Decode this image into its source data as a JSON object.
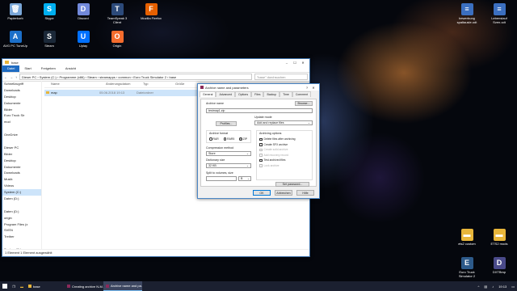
{
  "desktop": {
    "icons_top": [
      {
        "label": "Papierkorb",
        "icon": "recycle-bin-icon",
        "color": "#7aa7d8",
        "glyph": "🗑"
      },
      {
        "label": "Skype",
        "icon": "skype-icon",
        "color": "#00aff0",
        "glyph": "S"
      },
      {
        "label": "Discord",
        "icon": "discord-icon",
        "color": "#7289da",
        "glyph": "D"
      },
      {
        "label": "TeamSpeak 3 Client",
        "icon": "teamspeak-icon",
        "color": "#2c4a7a",
        "glyph": "T"
      },
      {
        "label": "Mozilla Firefox",
        "icon": "firefox-icon",
        "color": "#e66000",
        "glyph": "F"
      }
    ],
    "icons_second": [
      {
        "label": "AVG PC TuneUp",
        "icon": "avg-tuneup-icon",
        "color": "#1b6fc9",
        "glyph": "A"
      },
      {
        "label": "Steam",
        "icon": "steam-icon",
        "color": "#1b2838",
        "glyph": "S"
      },
      {
        "label": "Uplay",
        "icon": "uplay-icon",
        "color": "#0070ff",
        "glyph": "U"
      },
      {
        "label": "Origin",
        "icon": "origin-icon",
        "color": "#f56c2d",
        "glyph": "O"
      }
    ],
    "icons_right_top": [
      {
        "label": "bewerbung spaltausle.odt",
        "icon": "document-icon",
        "color": "#3b6fc0",
        "glyph": "≡"
      },
      {
        "label": "Lebenslauf Sven.odt",
        "icon": "document-icon",
        "color": "#3b6fc0",
        "glyph": "≡"
      }
    ],
    "icons_right_bottom": [
      {
        "label": "ets2 custom",
        "icon": "folder-icon",
        "color": "#e8b53a",
        "glyph": "▬"
      },
      {
        "label": "ETS2 mods",
        "icon": "folder-icon",
        "color": "#e8b53a",
        "glyph": "▬"
      },
      {
        "label": "Euro Truck Simulator 2",
        "icon": "ets2-icon",
        "color": "#2d5a8a",
        "glyph": "E"
      },
      {
        "label": "DXTBmp",
        "icon": "dxtbmp-icon",
        "color": "#4a4a8a",
        "glyph": "D"
      }
    ]
  },
  "explorer": {
    "title": "base",
    "tabs": [
      "Datei",
      "Start",
      "Freigeben",
      "Ansicht"
    ],
    "path": "Dieser PC  ›  System (C:)  ›  Programme (x86)  ›  Steam  ›  steamapps  ›  common  ›  Euro Truck Simulator 2  ›  base",
    "search_placeholder": "\"base\" durchsuchen",
    "nav": [
      {
        "label": "Schnellzugriff",
        "sel": false
      },
      {
        "label": "Downloads",
        "sel": false
      },
      {
        "label": "Desktop",
        "sel": false
      },
      {
        "label": "Dokumente",
        "sel": false
      },
      {
        "label": "Bilder",
        "sel": false
      },
      {
        "label": "Euro Truck Sir",
        "sel": false
      },
      {
        "label": "mod",
        "sel": false
      },
      {
        "label": "",
        "sel": false
      },
      {
        "label": "OneDrive",
        "sel": false
      },
      {
        "label": "",
        "sel": false
      },
      {
        "label": "Dieser PC",
        "sel": false
      },
      {
        "label": "Bilder",
        "sel": false
      },
      {
        "label": "Desktop",
        "sel": false
      },
      {
        "label": "Dokumente",
        "sel": false
      },
      {
        "label": "Downloads",
        "sel": false
      },
      {
        "label": "Musik",
        "sel": false
      },
      {
        "label": "Videos",
        "sel": false
      },
      {
        "label": "System (C:)",
        "sel": true
      },
      {
        "label": "Daten (D:)",
        "sel": false
      },
      {
        "label": "",
        "sel": false
      },
      {
        "label": "Daten (D:)",
        "sel": false
      },
      {
        "label": "origin",
        "sel": false
      },
      {
        "label": "Program Files (x",
        "sel": false
      },
      {
        "label": "SVEN",
        "sel": false
      },
      {
        "label": "Treiber",
        "sel": false
      },
      {
        "label": "",
        "sel": false
      },
      {
        "label": "System (C:)",
        "sel": false
      }
    ],
    "headers": {
      "name": "Name",
      "date": "Änderungsdatum",
      "type": "Typ",
      "size": "Größe"
    },
    "rows": [
      {
        "name": "map",
        "date": "05.06.2018 19:13",
        "type": "Dateiordner"
      }
    ],
    "status": "1 Element    1 Element ausgewählt"
  },
  "dialog": {
    "title": "Archive name and parameters",
    "help": "?",
    "close": "✕",
    "tabs": [
      "General",
      "Advanced",
      "Options",
      "Files",
      "Backup",
      "Time",
      "Comment"
    ],
    "archive_name_label": "Archive name",
    "archive_name_value": "testmap1.zip",
    "browse": "Browse...",
    "update_mode_label": "Update mode",
    "update_mode_value": "Add and replace files",
    "profiles": "Profiles...",
    "archive_format_label": "Archive format",
    "formats": [
      {
        "label": "RAR",
        "on": false
      },
      {
        "label": "RAR5",
        "on": false
      },
      {
        "label": "ZIP",
        "on": true
      }
    ],
    "compression_label": "Compression method",
    "compression_value": "Store",
    "dict_label": "Dictionary size",
    "dict_value": "32 KB",
    "split_label": "Split to volumes, size",
    "split_unit": "B",
    "archiving_options_label": "Archiving options",
    "options": [
      {
        "label": "Delete files after archiving",
        "enabled": true
      },
      {
        "label": "Create SFX archive",
        "enabled": true
      },
      {
        "label": "Create solid archive",
        "enabled": false
      },
      {
        "label": "Add recovery record",
        "enabled": false
      },
      {
        "label": "Test archived files",
        "enabled": true
      },
      {
        "label": "Lock archive",
        "enabled": false
      }
    ],
    "set_password": "Set password...",
    "ok": "OK",
    "cancel": "Abbrechen",
    "help_btn": "Hilfe"
  },
  "taskbar": {
    "items": [
      {
        "label": "base",
        "active": false,
        "color": "#e8b53a"
      },
      {
        "label": "Creating archive N-M...",
        "active": false,
        "color": "#8a2a5a"
      },
      {
        "label": "Archive name and pa...",
        "active": true,
        "color": "#8a2a5a"
      }
    ],
    "time": "19:13"
  }
}
